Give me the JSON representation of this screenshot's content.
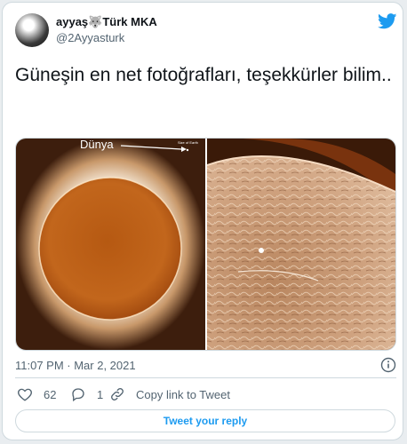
{
  "user": {
    "display_name": "ayyaş🐺Türk MKA",
    "handle": "@2Ayyasturk"
  },
  "tweet": {
    "text": "Güneşin en net fotoğrafları, teşekkürler bilim..",
    "timestamp": "11:07 PM · Mar 2, 2021"
  },
  "media": {
    "label_earth": "Dünya",
    "label_size": "Size of Earth"
  },
  "actions": {
    "likes": "62",
    "replies": "1",
    "copy_link": "Copy link to Tweet",
    "reply_button": "Tweet your reply"
  },
  "colors": {
    "twitter_blue": "#1d9bf0",
    "sun_orange": "#b85a12"
  }
}
